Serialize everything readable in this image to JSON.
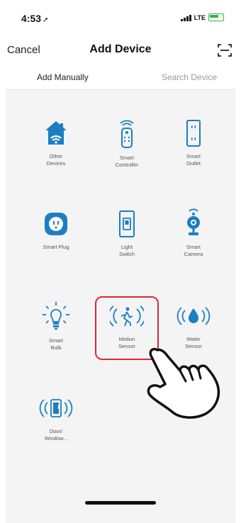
{
  "status_bar": {
    "time": "4:53",
    "network": "LTE"
  },
  "nav": {
    "cancel_label": "Cancel",
    "title": "Add Device"
  },
  "tabs": {
    "manual": "Add Manually",
    "search": "Search Device"
  },
  "devices": [
    {
      "label": "Other\nDevices",
      "icon": "home-icon"
    },
    {
      "label": "Smart\nController",
      "icon": "remote-control-icon"
    },
    {
      "label": "Smart\nOutlet",
      "icon": "outlet-icon"
    },
    {
      "label": "Smart Plug",
      "icon": "plug-icon"
    },
    {
      "label": "Light\nSwitch",
      "icon": "light-switch-icon"
    },
    {
      "label": "Smart\nCamera",
      "icon": "camera-icon"
    },
    {
      "label": "Smart\nBulb",
      "icon": "bulb-icon"
    },
    {
      "label": "Motion\nSensor",
      "icon": "motion-sensor-icon"
    },
    {
      "label": "Water\nSensor",
      "icon": "water-sensor-icon"
    },
    {
      "label": "Door/\nWindow...",
      "icon": "door-window-sensor-icon"
    }
  ],
  "colors": {
    "accent": "#1b7fc1",
    "highlight": "#d42b3a",
    "battery": "#2eb84b"
  }
}
